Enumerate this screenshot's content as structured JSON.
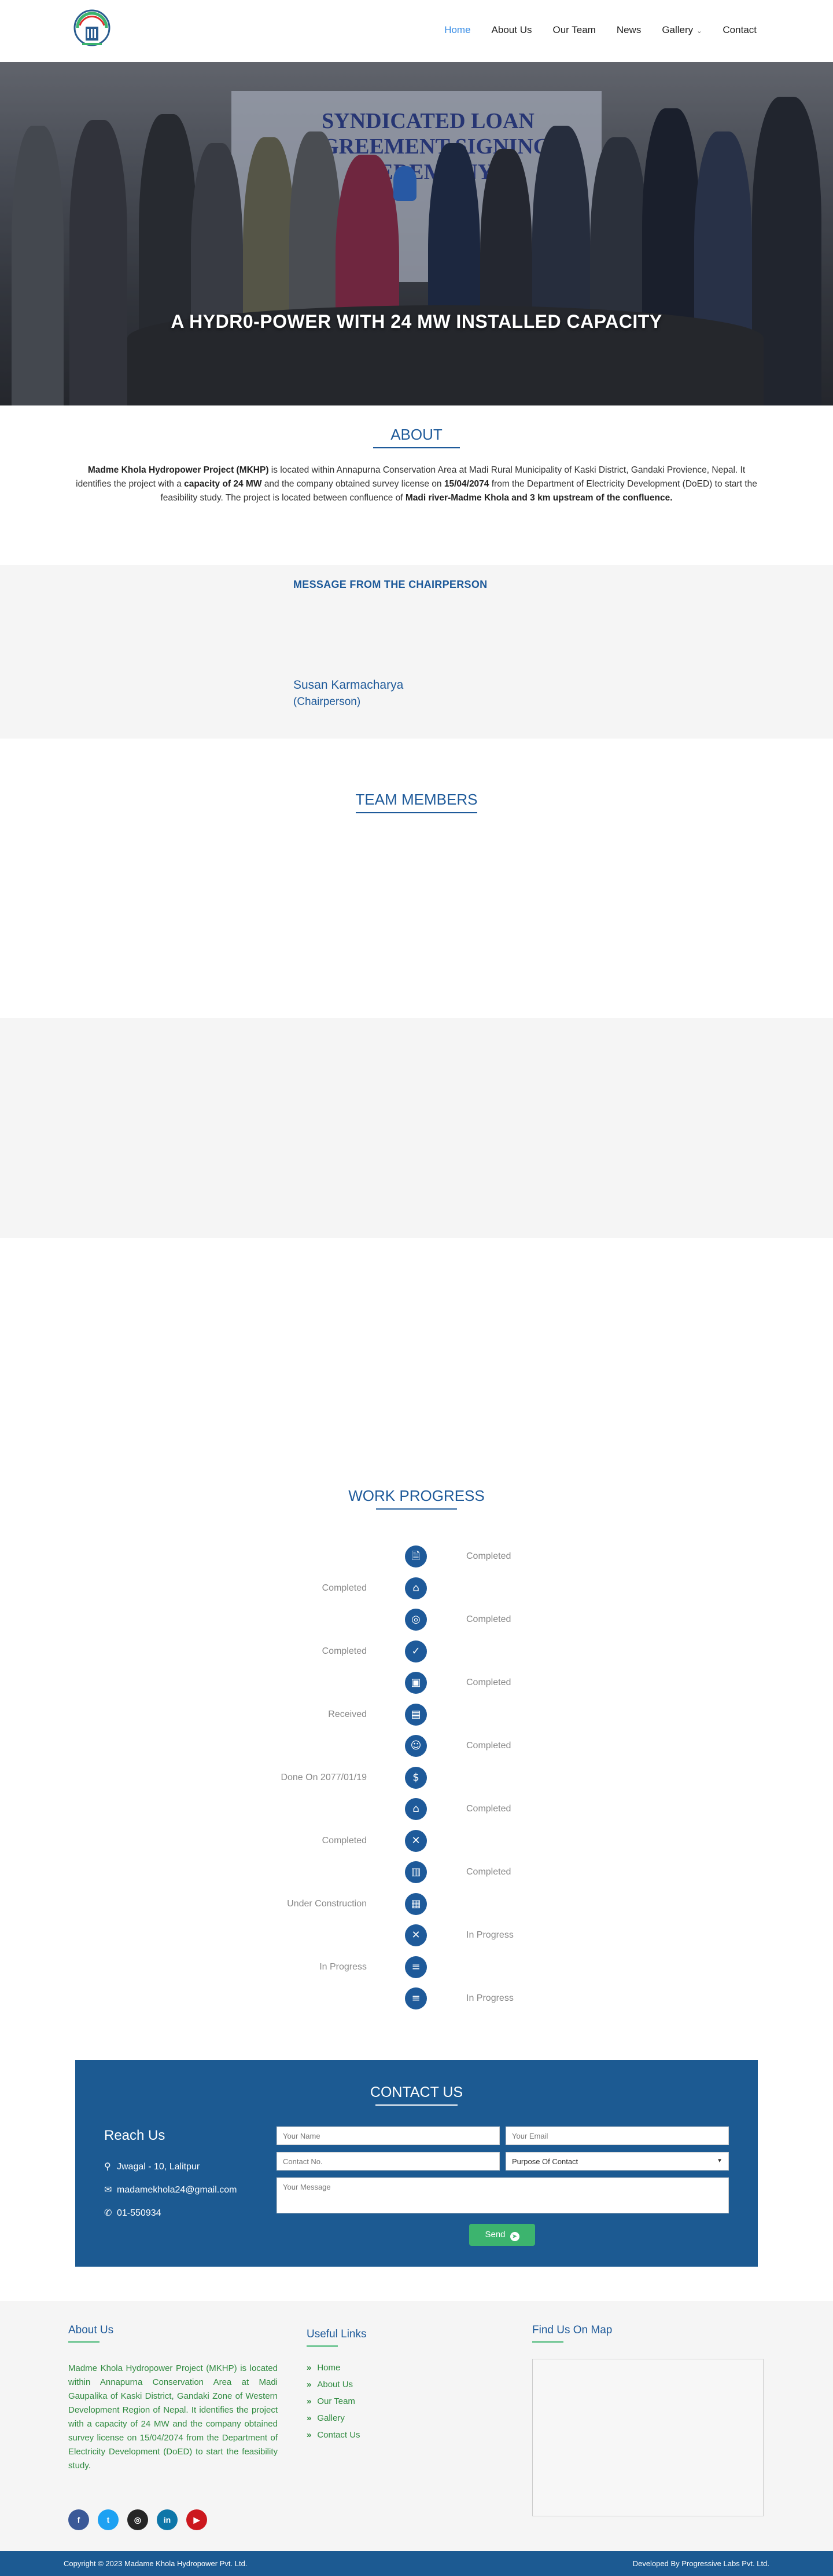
{
  "nav": {
    "items": [
      "Home",
      "About Us",
      "Our Team",
      "News",
      "Gallery",
      "Contact"
    ],
    "active": "Home",
    "active_color": "#3a8ee6"
  },
  "hero": {
    "banner_text": "SYNDICATED LOAN AGREEMENT SIGNING CEREMONY",
    "title": "A HYDR0-POWER WITH 24 MW INSTALLED CAPACITY"
  },
  "about": {
    "heading": "ABOUT",
    "p1_bold": "Madme Khola Hydropower Project (MKHP)",
    "p1_a": " is located within Annapurna Conservation Area at Madi Rural Municipality of Kaski District, Gandaki Provience, Nepal. It identifies the project with a ",
    "p1_b_bold": "capacity of 24 MW",
    "p1_c": " and the company obtained survey license on ",
    "p1_d_bold": "15/04/2074",
    "p1_e": " from the Department of Electricity Development (DoED) to start the feasibility study. The project is located between confluence of ",
    "p1_f_bold": "Madi river-Madme Khola and 3 km upstream of the confluence."
  },
  "chair": {
    "label": "MESSAGE FROM THE CHAIRPERSON",
    "name": "Susan Karmacharya",
    "role": "(Chairperson)"
  },
  "team": {
    "heading": "TEAM MEMBERS"
  },
  "progress": {
    "heading": "WORK PROGRESS",
    "items": [
      {
        "icon": "document-icon",
        "glyph": "🗎",
        "status": "Completed",
        "side": "right"
      },
      {
        "icon": "survey-icon",
        "glyph": "⌂",
        "status": "Completed",
        "side": "left"
      },
      {
        "icon": "globe-icon",
        "glyph": "◎",
        "status": "Completed",
        "side": "right"
      },
      {
        "icon": "check-icon",
        "glyph": "✓",
        "status": "Completed",
        "side": "left"
      },
      {
        "icon": "calendar-check-icon",
        "glyph": "▣",
        "status": "Completed",
        "side": "right"
      },
      {
        "icon": "license-icon",
        "glyph": "▤",
        "status": "Received",
        "side": "left"
      },
      {
        "icon": "users-icon",
        "glyph": "☺",
        "status": "Completed",
        "side": "right"
      },
      {
        "icon": "money-icon",
        "glyph": "$",
        "status": "Done On 2077/01/19",
        "side": "left"
      },
      {
        "icon": "building-icon",
        "glyph": "⌂",
        "status": "Completed",
        "side": "right"
      },
      {
        "icon": "tools-icon",
        "glyph": "✕",
        "status": "Completed",
        "side": "left"
      },
      {
        "icon": "bank-icon",
        "glyph": "▥",
        "status": "Completed",
        "side": "right"
      },
      {
        "icon": "construction-icon",
        "glyph": "▦",
        "status": "Under Construction",
        "side": "left"
      },
      {
        "icon": "wrench-icon",
        "glyph": "✕",
        "status": "In Progress",
        "side": "right"
      },
      {
        "icon": "list-icon",
        "glyph": "≡",
        "status": "In Progress",
        "side": "left"
      },
      {
        "icon": "menu-icon",
        "glyph": "≡",
        "status": "In Progress",
        "side": "right"
      }
    ]
  },
  "contact": {
    "heading": "CONTACT US",
    "reach_title": "Reach Us",
    "address": "Jwagal - 10, Lalitpur",
    "email": "madamekhola24@gmail.com",
    "phone": "01-550934",
    "placeholders": {
      "name": "Your Name",
      "email": "Your Email",
      "contact": "Contact No.",
      "message": "Your Message"
    },
    "purpose_selected": "Purpose Of Contact",
    "send_label": "Send"
  },
  "footer": {
    "about_heading": "About Us",
    "about_text": "Madme Khola Hydropower Project (MKHP) is located within Annapurna Conservation Area at Madi Gaupalika of Kaski District, Gandaki Zone of Western Development Region of Nepal. It identifies the project with a capacity of 24 MW and the company obtained survey license on 15/04/2074 from the Department of Electricity Development (DoED) to start the feasibility study.",
    "links_heading": "Useful Links",
    "links": [
      "Home",
      "About Us",
      "Our Team",
      "Gallery",
      "Contact Us"
    ],
    "map_heading": "Find Us On Map",
    "socials": [
      {
        "name": "facebook-icon",
        "glyph": "f",
        "color": "#3b5998"
      },
      {
        "name": "twitter-icon",
        "glyph": "t",
        "color": "#1da1f2"
      },
      {
        "name": "instagram-icon",
        "glyph": "◎",
        "color": "#262626"
      },
      {
        "name": "linkedin-icon",
        "glyph": "in",
        "color": "#0e76a8"
      },
      {
        "name": "youtube-icon",
        "glyph": "▶",
        "color": "#cc181e"
      }
    ],
    "copyright": "Copyright © 2023 Madame Khola Hydropower Pvt. Ltd.",
    "developer": "Developed By Progressive Labs Pvt. Ltd."
  }
}
